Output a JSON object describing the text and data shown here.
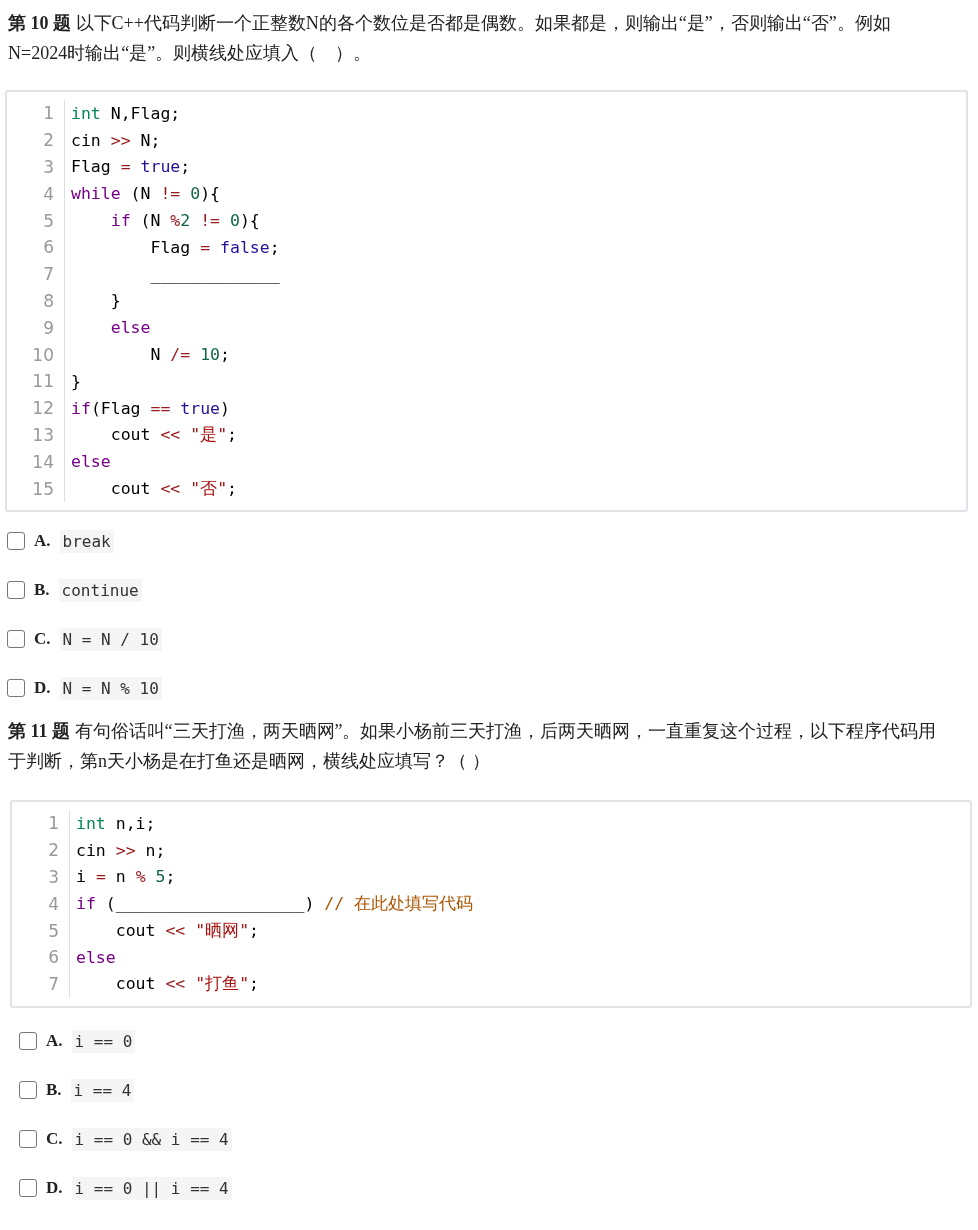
{
  "questions": [
    {
      "prompt": "**第 10 题** 以下C++代码判断一个正整数N的各个数位是否都是偶数。如果都是，则输出“是”，否则输出“否”。例如N=2024时输出“是”。则横线处应填入（　）。",
      "code": [
        {
          "no": "1",
          "tokens": [
            {
              "kind": "type",
              "text": "int"
            },
            {
              "kind": "plain",
              "text": " N,Flag;"
            }
          ]
        },
        {
          "no": "2",
          "tokens": [
            {
              "kind": "plain",
              "text": "cin "
            },
            {
              "kind": "op",
              "text": ">>"
            },
            {
              "kind": "plain",
              "text": " N;"
            }
          ]
        },
        {
          "no": "3",
          "tokens": [
            {
              "kind": "plain",
              "text": "Flag "
            },
            {
              "kind": "op",
              "text": "="
            },
            {
              "kind": "atom",
              "text": " true"
            },
            {
              "kind": "plain",
              "text": ";"
            }
          ]
        },
        {
          "no": "4",
          "tokens": [
            {
              "kind": "kw",
              "text": "while"
            },
            {
              "kind": "plain",
              "text": " (N "
            },
            {
              "kind": "op",
              "text": "!="
            },
            {
              "kind": "num",
              "text": " 0"
            },
            {
              "kind": "plain",
              "text": "){"
            }
          ]
        },
        {
          "no": "5",
          "tokens": [
            {
              "kind": "kw",
              "text": "    if"
            },
            {
              "kind": "plain",
              "text": " (N "
            },
            {
              "kind": "op",
              "text": "%"
            },
            {
              "kind": "num",
              "text": "2"
            },
            {
              "kind": "op",
              "text": " !="
            },
            {
              "kind": "num",
              "text": " 0"
            },
            {
              "kind": "plain",
              "text": "){"
            }
          ]
        },
        {
          "no": "6",
          "tokens": [
            {
              "kind": "plain",
              "text": "        Flag "
            },
            {
              "kind": "op",
              "text": "="
            },
            {
              "kind": "atom",
              "text": " false"
            },
            {
              "kind": "plain",
              "text": ";"
            }
          ]
        },
        {
          "no": "7",
          "tokens": [
            {
              "kind": "plain",
              "text": "        _____________"
            }
          ]
        },
        {
          "no": "8",
          "tokens": [
            {
              "kind": "plain",
              "text": "    }"
            }
          ]
        },
        {
          "no": "9",
          "tokens": [
            {
              "kind": "kw",
              "text": "    else"
            }
          ]
        },
        {
          "no": "10",
          "tokens": [
            {
              "kind": "plain",
              "text": "        N "
            },
            {
              "kind": "op",
              "text": "/="
            },
            {
              "kind": "num",
              "text": " 10"
            },
            {
              "kind": "plain",
              "text": ";"
            }
          ]
        },
        {
          "no": "11",
          "tokens": [
            {
              "kind": "plain",
              "text": "}"
            }
          ]
        },
        {
          "no": "12",
          "tokens": [
            {
              "kind": "kw",
              "text": "if"
            },
            {
              "kind": "plain",
              "text": "(Flag "
            },
            {
              "kind": "op",
              "text": "=="
            },
            {
              "kind": "atom",
              "text": " true"
            },
            {
              "kind": "plain",
              "text": ")"
            }
          ]
        },
        {
          "no": "13",
          "tokens": [
            {
              "kind": "plain",
              "text": "    cout "
            },
            {
              "kind": "op",
              "text": "<<"
            },
            {
              "kind": "str",
              "text": " \"是\""
            },
            {
              "kind": "plain",
              "text": ";"
            }
          ]
        },
        {
          "no": "14",
          "tokens": [
            {
              "kind": "kw",
              "text": "else"
            }
          ]
        },
        {
          "no": "15",
          "tokens": [
            {
              "kind": "plain",
              "text": "    cout "
            },
            {
              "kind": "op",
              "text": "<<"
            },
            {
              "kind": "str",
              "text": " \"否\""
            },
            {
              "kind": "plain",
              "text": ";"
            }
          ]
        }
      ],
      "options": [
        {
          "letter": "A.",
          "text": "break",
          "checked": false
        },
        {
          "letter": "B.",
          "text": "continue",
          "checked": false
        },
        {
          "letter": "C.",
          "text": "N = N / 10",
          "checked": false
        },
        {
          "letter": "D.",
          "text": "N = N % 10",
          "checked": false
        }
      ]
    },
    {
      "prompt": "**第 11 题** 有句俗话叫“三天打渔，两天晒网”。如果小杨前三天打渔，后两天晒网，一直重复这个过程，以下程序代码用于判断，第n天小杨是在打鱼还是晒网，横线处应填写？（ ）",
      "code": [
        {
          "no": "1",
          "tokens": [
            {
              "kind": "type",
              "text": "int"
            },
            {
              "kind": "plain",
              "text": " n,i;"
            }
          ]
        },
        {
          "no": "2",
          "tokens": [
            {
              "kind": "plain",
              "text": "cin "
            },
            {
              "kind": "op",
              "text": ">>"
            },
            {
              "kind": "plain",
              "text": " n;"
            }
          ]
        },
        {
          "no": "3",
          "tokens": [
            {
              "kind": "plain",
              "text": "i "
            },
            {
              "kind": "op",
              "text": "="
            },
            {
              "kind": "plain",
              "text": " n "
            },
            {
              "kind": "op",
              "text": "%"
            },
            {
              "kind": "num",
              "text": " 5"
            },
            {
              "kind": "plain",
              "text": ";"
            }
          ]
        },
        {
          "no": "4",
          "tokens": [
            {
              "kind": "kw",
              "text": "if"
            },
            {
              "kind": "plain",
              "text": " (___________________) "
            },
            {
              "kind": "comment",
              "text": "// 在此处填写代码"
            }
          ]
        },
        {
          "no": "5",
          "tokens": [
            {
              "kind": "plain",
              "text": "    cout "
            },
            {
              "kind": "op",
              "text": "<<"
            },
            {
              "kind": "str",
              "text": " \"晒网\""
            },
            {
              "kind": "plain",
              "text": ";"
            }
          ]
        },
        {
          "no": "6",
          "tokens": [
            {
              "kind": "kw",
              "text": "else"
            }
          ]
        },
        {
          "no": "7",
          "tokens": [
            {
              "kind": "plain",
              "text": "    cout "
            },
            {
              "kind": "op",
              "text": "<<"
            },
            {
              "kind": "str",
              "text": " \"打鱼\""
            },
            {
              "kind": "plain",
              "text": ";"
            }
          ]
        }
      ],
      "options": [
        {
          "letter": "A.",
          "text": "i == 0",
          "checked": false
        },
        {
          "letter": "B.",
          "text": "i == 4",
          "checked": false
        },
        {
          "letter": "C.",
          "text": "i == 0 && i == 4",
          "checked": false
        },
        {
          "letter": "D.",
          "text": "i == 0 || i == 4",
          "checked": false
        }
      ]
    }
  ]
}
